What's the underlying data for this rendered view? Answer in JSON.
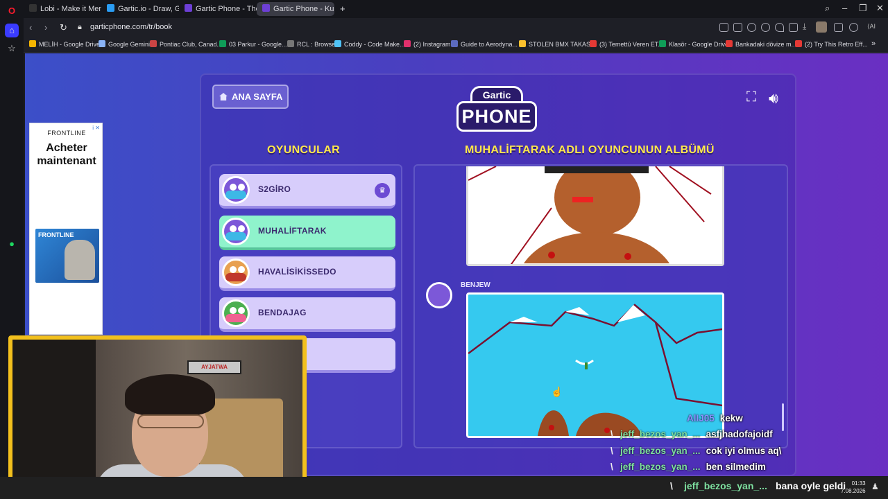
{
  "browser": {
    "tabs": [
      {
        "label": "Lobi - Make it Meme",
        "color": "#333"
      },
      {
        "label": "Gartic.io - Draw, Guess, W",
        "color": "#2a9df4"
      },
      {
        "label": "Gartic Phone - The Teleph",
        "color": "#6d3fd6"
      },
      {
        "label": "Gartic Phone - Kulaktan K",
        "color": "#6d3fd6"
      }
    ],
    "new_tab": "+",
    "url": "garticphone.com/tr/book",
    "bookmarks": [
      {
        "label": "MELİH - Google Drive",
        "color": "#f4b400"
      },
      {
        "label": "Google Gemini",
        "color": "#8ab4f8"
      },
      {
        "label": "Pontiac Club, Canad...",
        "color": "#c44"
      },
      {
        "label": "03 Parkur - Google...",
        "color": "#0f9d58"
      },
      {
        "label": "RCL : Browse",
        "color": "#777"
      },
      {
        "label": "Coddy - Code Make...",
        "color": "#4fc3f7"
      },
      {
        "label": "(2) Instagram",
        "color": "#e1306c"
      },
      {
        "label": "Guide to Aerodyna...",
        "color": "#5c6bc0"
      },
      {
        "label": "STOLEN BMX TAKAS...",
        "color": "#fbc02d"
      },
      {
        "label": "(3) Temettü Veren ET...",
        "color": "#e53935"
      },
      {
        "label": "Klasör - Google Drive",
        "color": "#0f9d58"
      },
      {
        "label": "Bankadaki dövize m...",
        "color": "#e53935"
      },
      {
        "label": "(2) Try This Retro Eff...",
        "color": "#e53935"
      }
    ]
  },
  "ad": {
    "brand": "FRONTLINE",
    "cta": "Acheter maintenant",
    "product": "FRONTLINE",
    "tag": "i ✕"
  },
  "game": {
    "home_label": "ANA SAYFA",
    "logo_top": "Gartic",
    "logo_main": "PHONE",
    "players_title": "OYUNCULAR",
    "album_title": "MUHALİFTARAK ADLI OYUNCUNUN ALBÜMÜ",
    "players": [
      {
        "name": "S2GİRO",
        "host": true,
        "active": false
      },
      {
        "name": "MUHALİFTARAK",
        "host": false,
        "active": true
      },
      {
        "name": "HAVALİSİKİSSEDO",
        "host": false,
        "active": false
      },
      {
        "name": "BENDAJAG",
        "host": false,
        "active": false
      },
      {
        "name": "",
        "host": false,
        "active": false
      }
    ],
    "album_author": "BENJEW"
  },
  "webcam": {
    "poster_text": "AYJATWA"
  },
  "chat": [
    {
      "user": "AlIJ05",
      "message": "kekw",
      "color": "#8a8fff"
    },
    {
      "user": "jeff_bezos_yan_...",
      "message": "asfjhadofajoidf",
      "color": "#7ee0a0"
    },
    {
      "user": "jeff_bezos_yan_...",
      "message": "cok iyi olmus aq\\",
      "color": "#7ee0a0"
    },
    {
      "user": "jeff_bezos_yan_...",
      "message": "ben silmedim",
      "color": "#7ee0a0"
    }
  ],
  "taskbar": {
    "chat_user": "jeff_bezos_yan_...",
    "chat_message": "bana oyle geldi",
    "time": "01:33",
    "date": "7.08.2026"
  }
}
